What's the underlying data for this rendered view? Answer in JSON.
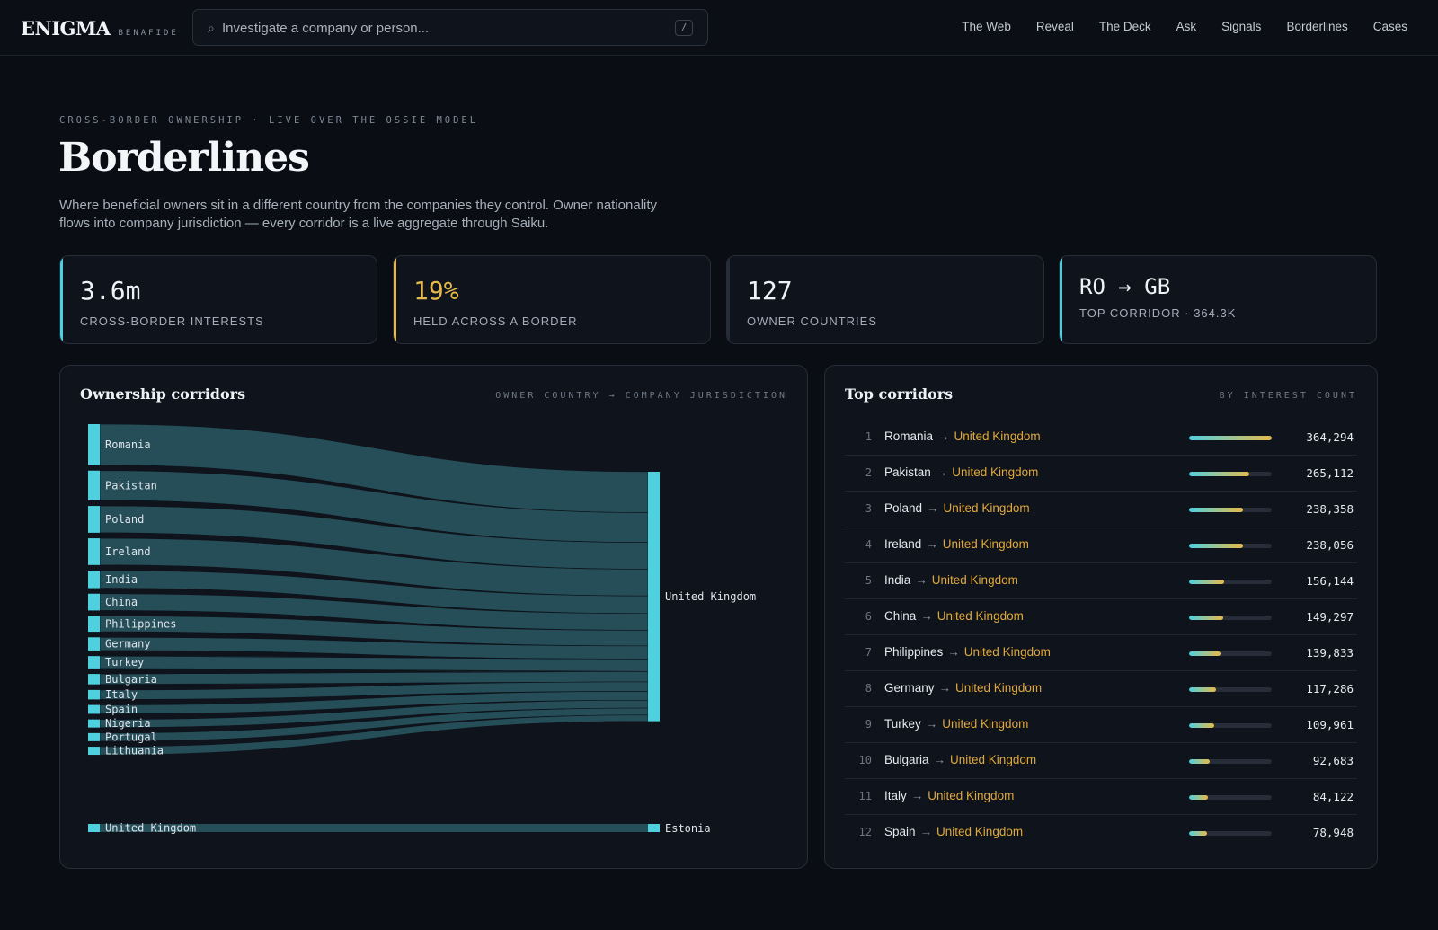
{
  "header": {
    "brand": "ENIGMA",
    "brand_sub": "BENAFIDE",
    "search_placeholder": "Investigate a company or person...",
    "search_shortcut": "/",
    "nav": [
      "The Web",
      "Reveal",
      "The Deck",
      "Ask",
      "Signals",
      "Borderlines",
      "Cases"
    ]
  },
  "hero": {
    "eyebrow": "CROSS-BORDER OWNERSHIP · LIVE OVER THE OSSIE MODEL",
    "title": "Borderlines",
    "description": "Where beneficial owners sit in a different country from the companies they control. Owner nationality flows into company jurisdiction — every corridor is a live aggregate through Saiku."
  },
  "stats": [
    {
      "value": "3.6m",
      "label": "CROSS-BORDER INTERESTS",
      "accent": "#4fd0df"
    },
    {
      "value": "19%",
      "label": "HELD ACROSS A BORDER",
      "accent": "#e6b94a",
      "value_color": "#e6b94a"
    },
    {
      "value": "127",
      "label": "OWNER COUNTRIES",
      "accent": "#262d38"
    },
    {
      "value": "RO → GB",
      "label": "TOP CORRIDOR · 364.3K",
      "accent": "#4fd0df"
    }
  ],
  "sankey": {
    "title": "Ownership corridors",
    "subtitle": "OWNER COUNTRY → COMPANY JURISDICTION",
    "sources": [
      {
        "name": "Romania",
        "value": 364294
      },
      {
        "name": "Pakistan",
        "value": 265112
      },
      {
        "name": "Poland",
        "value": 238358
      },
      {
        "name": "Ireland",
        "value": 238056
      },
      {
        "name": "India",
        "value": 156144
      },
      {
        "name": "China",
        "value": 149297
      },
      {
        "name": "Philippines",
        "value": 139833
      },
      {
        "name": "Germany",
        "value": 117286
      },
      {
        "name": "Turkey",
        "value": 109961
      },
      {
        "name": "Bulgaria",
        "value": 92683
      },
      {
        "name": "Italy",
        "value": 84122
      },
      {
        "name": "Spain",
        "value": 78948
      },
      {
        "name": "Nigeria",
        "value": 70000
      },
      {
        "name": "Portugal",
        "value": 62000
      },
      {
        "name": "Lithuania",
        "value": 55000
      },
      {
        "name": "United Kingdom",
        "value": 50000,
        "target": "Estonia"
      }
    ],
    "targets": [
      "United Kingdom",
      "Estonia"
    ],
    "colors": {
      "node": "#4fd0df",
      "link": "#2c5f6a"
    }
  },
  "top": {
    "title": "Top corridors",
    "subtitle": "BY INTEREST COUNT",
    "max": 364294,
    "rows": [
      {
        "rank": "1",
        "from": "Romania",
        "to": "United Kingdom",
        "count": "364,294",
        "value": 364294
      },
      {
        "rank": "2",
        "from": "Pakistan",
        "to": "United Kingdom",
        "count": "265,112",
        "value": 265112
      },
      {
        "rank": "3",
        "from": "Poland",
        "to": "United Kingdom",
        "count": "238,358",
        "value": 238358
      },
      {
        "rank": "4",
        "from": "Ireland",
        "to": "United Kingdom",
        "count": "238,056",
        "value": 238056
      },
      {
        "rank": "5",
        "from": "India",
        "to": "United Kingdom",
        "count": "156,144",
        "value": 156144
      },
      {
        "rank": "6",
        "from": "China",
        "to": "United Kingdom",
        "count": "149,297",
        "value": 149297
      },
      {
        "rank": "7",
        "from": "Philippines",
        "to": "United Kingdom",
        "count": "139,833",
        "value": 139833
      },
      {
        "rank": "8",
        "from": "Germany",
        "to": "United Kingdom",
        "count": "117,286",
        "value": 117286
      },
      {
        "rank": "9",
        "from": "Turkey",
        "to": "United Kingdom",
        "count": "109,961",
        "value": 109961
      },
      {
        "rank": "10",
        "from": "Bulgaria",
        "to": "United Kingdom",
        "count": "92,683",
        "value": 92683
      },
      {
        "rank": "11",
        "from": "Italy",
        "to": "United Kingdom",
        "count": "84,122",
        "value": 84122
      },
      {
        "rank": "12",
        "from": "Spain",
        "to": "United Kingdom",
        "count": "78,948",
        "value": 78948
      }
    ]
  }
}
